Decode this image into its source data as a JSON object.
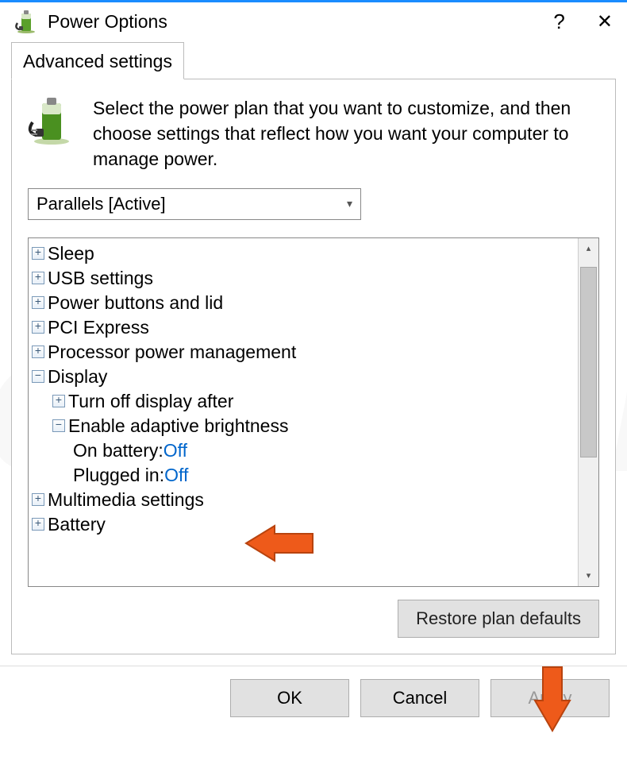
{
  "titlebar": {
    "title": "Power Options",
    "help": "?",
    "close": "✕"
  },
  "tab": {
    "label": "Advanced settings"
  },
  "intro": {
    "text": "Select the power plan that you want to customize, and then choose settings that reflect how you want your computer to manage power."
  },
  "plan_dropdown": {
    "selected": "Parallels [Active]"
  },
  "tree": {
    "items": [
      {
        "label": "Sleep",
        "exp": "+",
        "level": 1
      },
      {
        "label": "USB settings",
        "exp": "+",
        "level": 1
      },
      {
        "label": "Power buttons and lid",
        "exp": "+",
        "level": 1
      },
      {
        "label": "PCI Express",
        "exp": "+",
        "level": 1
      },
      {
        "label": "Processor power management",
        "exp": "+",
        "level": 1
      },
      {
        "label": "Display",
        "exp": "−",
        "level": 1
      },
      {
        "label": "Turn off display after",
        "exp": "+",
        "level": 2
      },
      {
        "label": "Enable adaptive brightness",
        "exp": "−",
        "level": 2
      },
      {
        "label": "On battery: ",
        "value": "Off",
        "level": 3
      },
      {
        "label": "Plugged in: ",
        "value": "Off",
        "level": 3
      },
      {
        "label": "Multimedia settings",
        "exp": "+",
        "level": 1
      },
      {
        "label": "Battery",
        "exp": "+",
        "level": 1
      }
    ]
  },
  "restore_label": "Restore plan defaults",
  "buttons": {
    "ok": "OK",
    "cancel": "Cancel",
    "apply": "Apply"
  },
  "watermark": "PCrisk.com"
}
